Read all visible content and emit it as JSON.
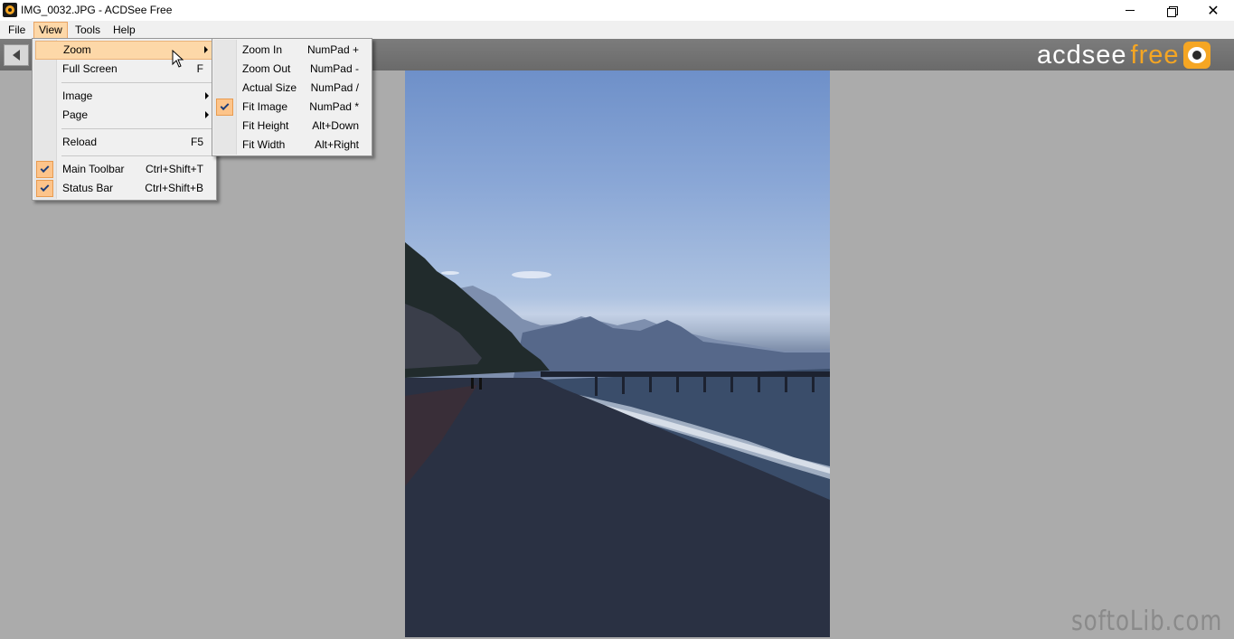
{
  "window": {
    "title": "IMG_0032.JPG - ACDSee Free",
    "icon": "acdsee-app-icon",
    "controls": {
      "minimize": "minimize-icon",
      "restore": "restore-icon",
      "close": "✕"
    }
  },
  "menubar": {
    "items": [
      {
        "label": "File",
        "accel": "F"
      },
      {
        "label": "View",
        "accel": "V",
        "active": true
      },
      {
        "label": "Tools",
        "accel": "T"
      },
      {
        "label": "Help",
        "accel": "H"
      }
    ]
  },
  "toolbar": {
    "back_icon": "arrow-left-icon",
    "brand": {
      "main": "acdsee",
      "accent": "free",
      "icon": "camera-eye-icon"
    }
  },
  "view_menu": {
    "items": [
      {
        "label": "Zoom",
        "shortcut": "",
        "submenu": true,
        "highlighted": true
      },
      {
        "label": "Full Screen",
        "shortcut": "F"
      },
      {
        "label": "Image",
        "shortcut": "",
        "submenu": true
      },
      {
        "label": "Page",
        "shortcut": "",
        "submenu": true
      },
      {
        "label": "Reload",
        "shortcut": "F5"
      },
      {
        "label": "Main Toolbar",
        "shortcut": "Ctrl+Shift+T",
        "checked": true
      },
      {
        "label": "Status Bar",
        "shortcut": "Ctrl+Shift+B",
        "checked": true
      }
    ]
  },
  "zoom_menu": {
    "items": [
      {
        "label": "Zoom In",
        "shortcut": "NumPad +"
      },
      {
        "label": "Zoom Out",
        "shortcut": "NumPad -"
      },
      {
        "label": "Actual Size",
        "shortcut": "NumPad /"
      },
      {
        "label": "Fit Image",
        "shortcut": "NumPad *",
        "checked": true
      },
      {
        "label": "Fit Height",
        "shortcut": "Alt+Down"
      },
      {
        "label": "Fit Width",
        "shortcut": "Alt+Right"
      }
    ]
  },
  "viewer": {
    "image_file": "IMG_0032.JPG",
    "image_subject": "pebble beach with pier and mountains at dusk"
  },
  "watermark": "softoLib.com",
  "colors": {
    "menu_highlight": "#fdd8a8",
    "brand_accent": "#f5a623",
    "viewer_bg": "#ababab"
  }
}
